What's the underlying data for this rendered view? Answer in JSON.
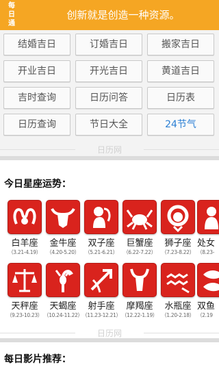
{
  "header": {
    "logo_chars": [
      "每",
      "日",
      "通"
    ],
    "motto": "创新就是创造一种资源。"
  },
  "grid_buttons": [
    {
      "label": "结婚吉日"
    },
    {
      "label": "订婚吉日"
    },
    {
      "label": "搬家吉日"
    },
    {
      "label": "开业吉日"
    },
    {
      "label": "开光吉日"
    },
    {
      "label": "黄道吉日"
    },
    {
      "label": "吉时查询"
    },
    {
      "label": "日历问答"
    },
    {
      "label": "日历表"
    },
    {
      "label": "日历查询"
    },
    {
      "label": "节日大全"
    },
    {
      "label": "24节气"
    }
  ],
  "watermark": "日历网",
  "horoscope": {
    "title": "今日星座运势：",
    "signs": [
      {
        "name": "白羊座",
        "dates": "（3.21-4.19）",
        "icon": "aries-icon"
      },
      {
        "name": "金牛座",
        "dates": "（4.20-5.20）",
        "icon": "taurus-icon"
      },
      {
        "name": "双子座",
        "dates": "（5.21-6.21）",
        "icon": "gemini-icon"
      },
      {
        "name": "巨蟹座",
        "dates": "（6.22-7.22）",
        "icon": "cancer-icon"
      },
      {
        "name": "狮子座",
        "dates": "（7.23-8.22）",
        "icon": "leo-icon"
      },
      {
        "name": "处女",
        "dates": "（8.23-",
        "icon": "virgo-icon"
      },
      {
        "name": "天秤座",
        "dates": "（9.23-10.23）",
        "icon": "libra-icon"
      },
      {
        "name": "天蝎座",
        "dates": "（10.24-11.22）",
        "icon": "scorpio-icon"
      },
      {
        "name": "射手座",
        "dates": "（11.23-12.21）",
        "icon": "sagittarius-icon"
      },
      {
        "name": "摩羯座",
        "dates": "（12.22-1.19）",
        "icon": "capricorn-icon"
      },
      {
        "name": "水瓶座",
        "dates": "（1.20-2.18）",
        "icon": "aquarius-icon"
      },
      {
        "name": "双鱼",
        "dates": "（2.19",
        "icon": "pisces-icon"
      }
    ]
  },
  "movies": {
    "title": "每日影片推荐："
  },
  "colors": {
    "header": "#f5a623",
    "accent": "#2a7fd4",
    "zodiac_red": "#d9231d"
  }
}
